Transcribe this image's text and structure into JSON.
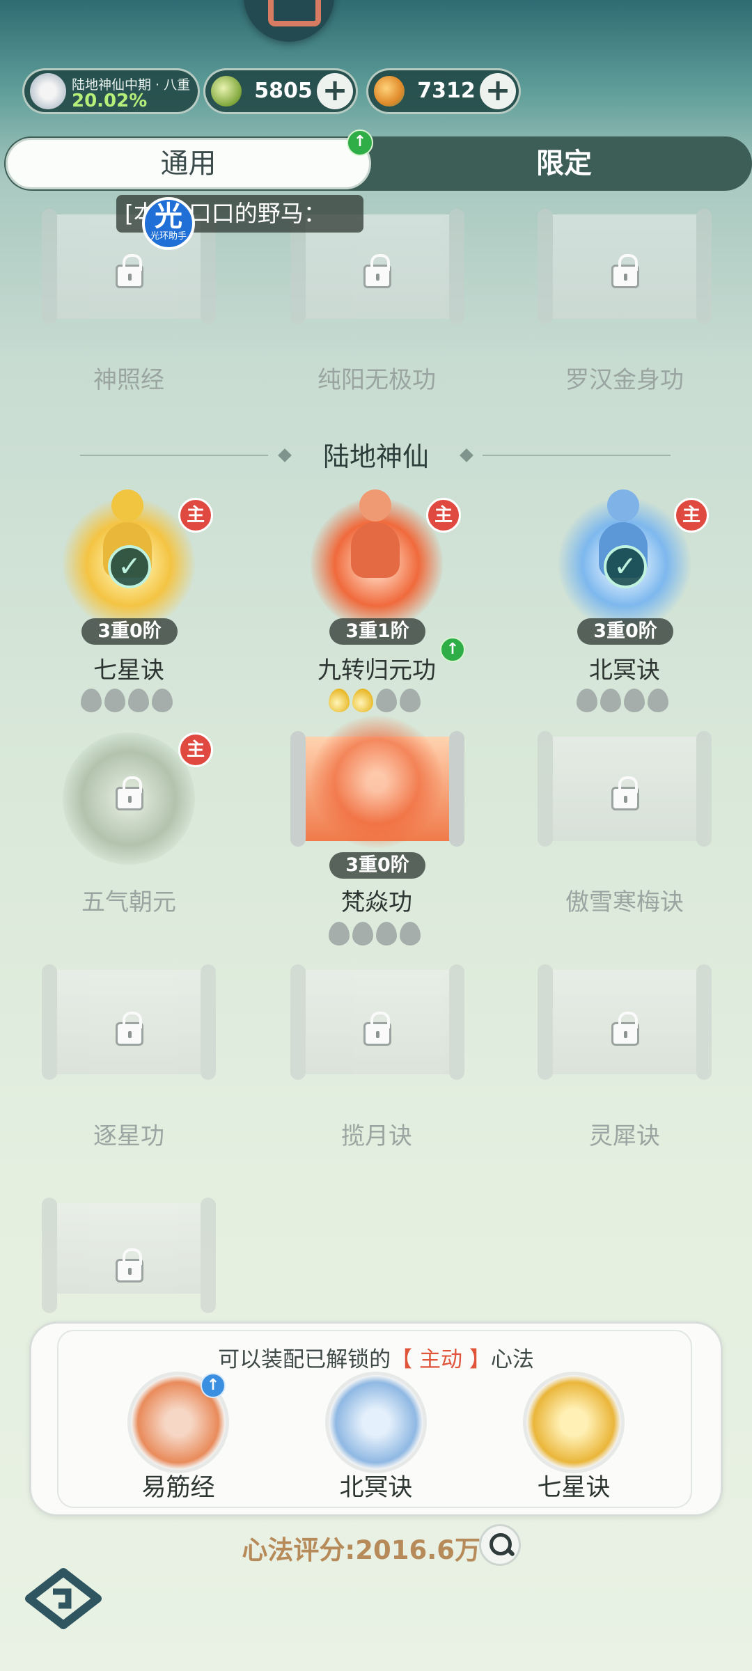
{
  "header": {
    "realm_label": "陆地神仙中期 · 八重",
    "progress_percent": "20.02%",
    "currency_1": {
      "icon": "spirit-stone-icon",
      "value": "5805",
      "add_label": "+"
    },
    "currency_2": {
      "icon": "peach-orb-icon",
      "value": "7312",
      "add_label": "+"
    }
  },
  "tabs": {
    "general": "通用",
    "limited": "限定",
    "general_badge": "↑"
  },
  "marquee": {
    "text": "[本服]口口的野马：",
    "helper_big": "光",
    "helper_small": "光环助手"
  },
  "locked_top": [
    "神照经",
    "纯阳无极功",
    "罗汉金身功"
  ],
  "section": {
    "title": "陆地神仙"
  },
  "skills": {
    "row1": [
      {
        "name": "七星诀",
        "rank": "3重0阶",
        "main": "主",
        "equipped": "✓",
        "gold_drops": 0
      },
      {
        "name": "九转归元功",
        "rank": "3重1阶",
        "main": "主",
        "upgrade": "↑",
        "gold_drops": 2
      },
      {
        "name": "北冥诀",
        "rank": "3重0阶",
        "main": "主",
        "equipped": "✓",
        "gold_drops": 0
      }
    ],
    "row2": [
      {
        "name": "五气朝元",
        "main": "主"
      },
      {
        "name": "梵焱功",
        "rank": "3重0阶",
        "gold_drops": 0
      },
      {
        "name": "傲雪寒梅诀"
      }
    ],
    "row3": [
      "逐星功",
      "揽月诀",
      "灵犀诀"
    ]
  },
  "panel": {
    "text_before": "可以装配已解锁的",
    "text_highlight": "【 主动 】",
    "text_after": "心法",
    "slots": [
      {
        "name": "易筋经",
        "badge": "↑"
      },
      {
        "name": "北冥诀"
      },
      {
        "name": "七星诀"
      }
    ]
  },
  "score": {
    "text": "心法评分:2016.6万"
  },
  "colors": {
    "highlight": "#e0543a",
    "badge_green": "#2fae47",
    "main_red": "#e0493f",
    "score_gold": "#b78a5a"
  }
}
